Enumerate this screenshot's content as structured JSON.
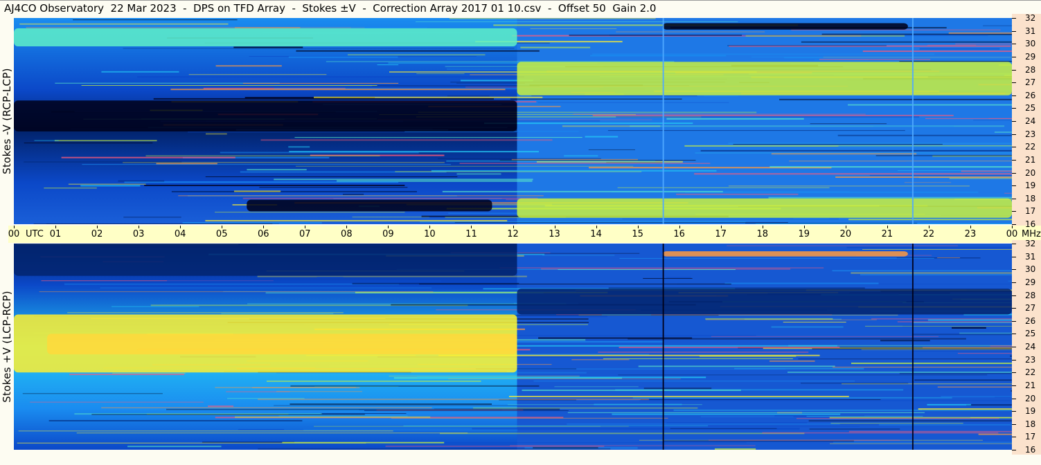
{
  "title": "AJ4CO Observatory  22 Mar 2023  -  DPS on TFD Array  -  Stokes ±V  -  Correction Array 2017 01 10.csv  -  Offset 50  Gain 2.0",
  "colors": {
    "background": "#fdfcf2",
    "time_axis_band": "#ffffc6",
    "freq_axis_band": "#fbe2cc",
    "colormap": [
      "#000018",
      "#02246e",
      "#0b48c8",
      "#1a8cf0",
      "#24c8f4",
      "#5ef0c8",
      "#c8f040",
      "#fff030",
      "#ff9a40",
      "#ff5a78"
    ]
  },
  "chart_data": [
    {
      "type": "heatmap",
      "name": "panel-top",
      "ylabel": "Stokes -V (RCP-LCP)",
      "xlabel": "UTC",
      "x_unit": "UTC",
      "y_unit": "MHz",
      "x_ticks": [
        "00",
        "01",
        "02",
        "03",
        "04",
        "05",
        "06",
        "07",
        "08",
        "09",
        "10",
        "11",
        "12",
        "13",
        "14",
        "15",
        "16",
        "17",
        "18",
        "19",
        "20",
        "21",
        "22",
        "23",
        "00"
      ],
      "y_ticks": [
        32,
        31,
        30,
        29,
        28,
        27,
        26,
        25,
        24,
        23,
        22,
        21,
        20,
        19,
        18,
        17,
        16
      ],
      "x_range_hours": [
        0,
        24
      ],
      "y_range_mhz": [
        16,
        32
      ],
      "features": [
        {
          "kind": "band",
          "t0": 0,
          "t1": 12.1,
          "f0": 29.8,
          "f1": 31.2,
          "level": 5
        },
        {
          "kind": "band",
          "t0": 0,
          "t1": 12.1,
          "f0": 23.2,
          "f1": 25.6,
          "level": 0
        },
        {
          "kind": "band",
          "t0": 5.6,
          "t1": 11.5,
          "f0": 17.0,
          "f1": 17.9,
          "level": 0
        },
        {
          "kind": "band",
          "t0": 15.6,
          "t1": 21.5,
          "f0": 31.1,
          "f1": 31.6,
          "level": 0
        },
        {
          "kind": "band",
          "t0": 12.1,
          "t1": 24,
          "f0": 26.0,
          "f1": 28.6,
          "level": 6
        },
        {
          "kind": "band",
          "t0": 12.1,
          "t1": 24,
          "f0": 16.5,
          "f1": 18.0,
          "level": 6
        }
      ]
    },
    {
      "type": "heatmap",
      "name": "panel-bottom",
      "ylabel": "Stokes +V (LCP-RCP)",
      "xlabel": "UTC",
      "x_unit": "UTC",
      "y_unit": "MHz",
      "x_ticks": [
        "00",
        "01",
        "02",
        "03",
        "04",
        "05",
        "06",
        "07",
        "08",
        "09",
        "10",
        "11",
        "12",
        "13",
        "14",
        "15",
        "16",
        "17",
        "18",
        "19",
        "20",
        "21",
        "22",
        "23",
        "00"
      ],
      "y_ticks": [
        32,
        31,
        30,
        29,
        28,
        27,
        26,
        25,
        24,
        23,
        22,
        21,
        20,
        19,
        18,
        17,
        16
      ],
      "x_range_hours": [
        0,
        24
      ],
      "y_range_mhz": [
        16,
        32
      ],
      "features": [
        {
          "kind": "band",
          "t0": 0,
          "t1": 12.1,
          "f0": 29.5,
          "f1": 32.0,
          "level": 1
        },
        {
          "kind": "band",
          "t0": 0.8,
          "t1": 12.1,
          "f0": 23.4,
          "f1": 25.0,
          "level": 9
        },
        {
          "kind": "band",
          "t0": 0,
          "t1": 12.1,
          "f0": 22.0,
          "f1": 26.5,
          "level": 7
        },
        {
          "kind": "band",
          "t0": 15.6,
          "t1": 21.5,
          "f0": 31.0,
          "f1": 31.4,
          "level": 8
        },
        {
          "kind": "band",
          "t0": 12.1,
          "t1": 24,
          "f0": 26.5,
          "f1": 28.5,
          "level": 1
        }
      ]
    }
  ],
  "time_axis": {
    "utc_label": "UTC",
    "mhz_label": "MHz"
  }
}
